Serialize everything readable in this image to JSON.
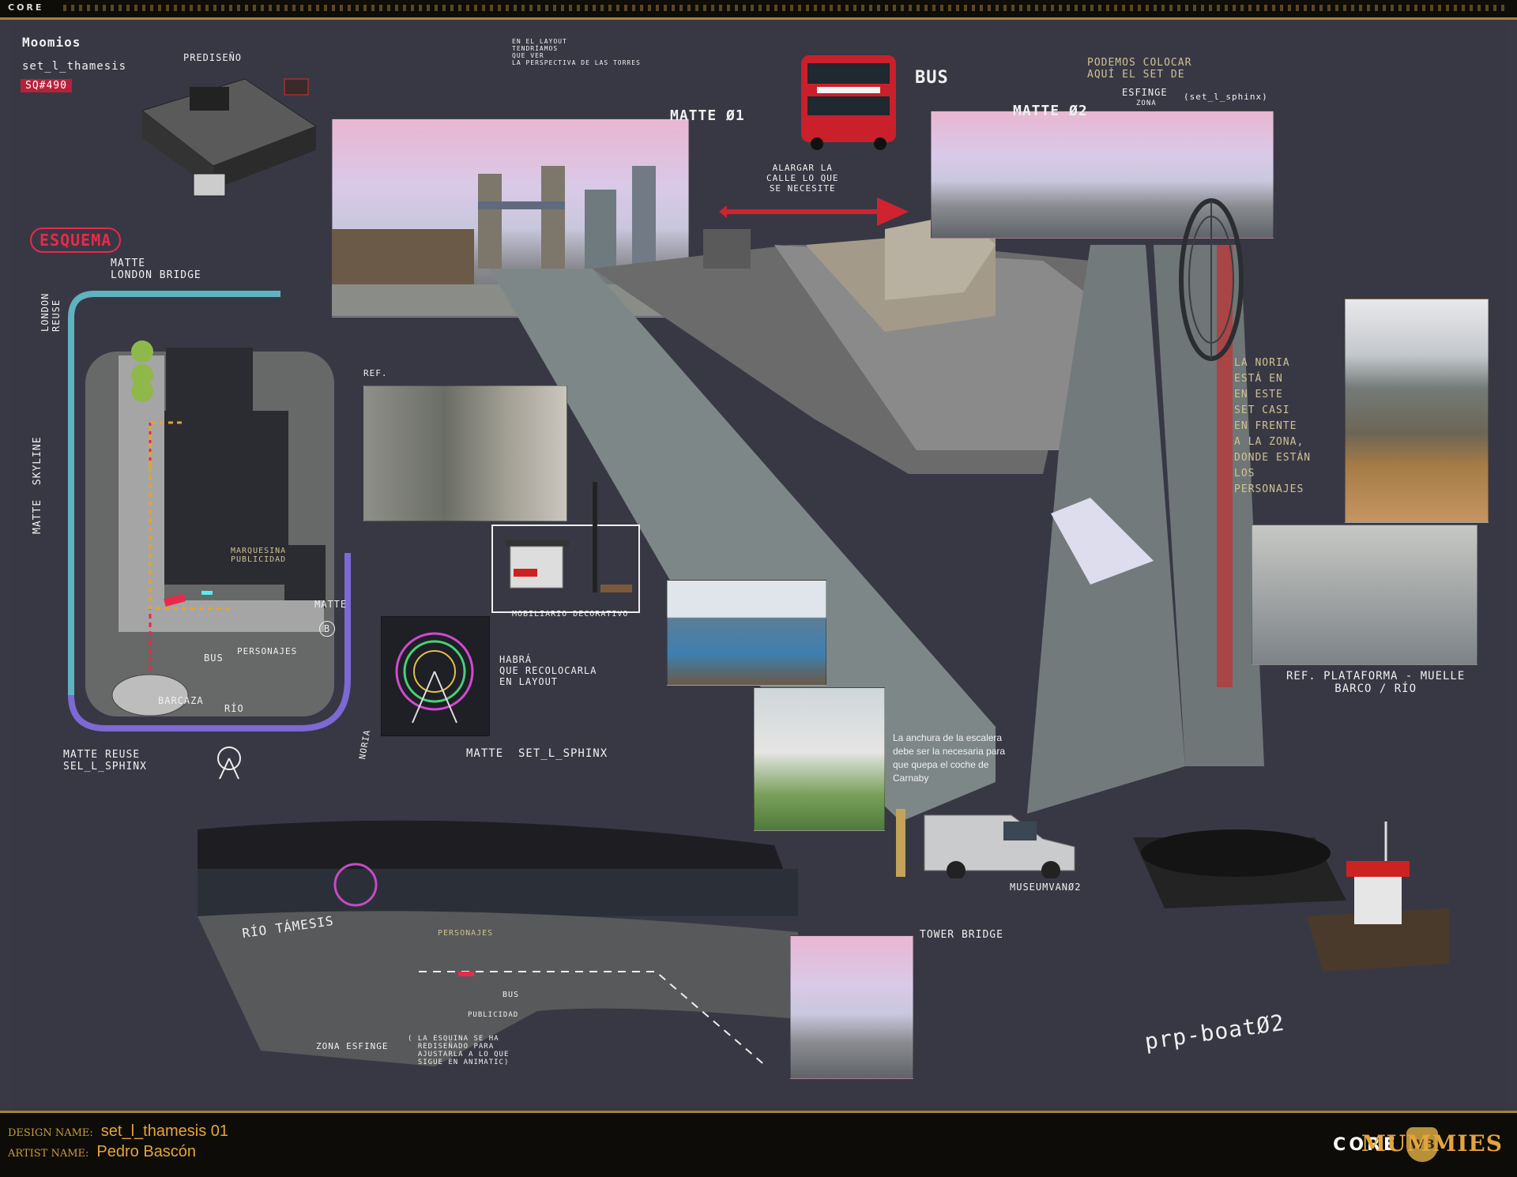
{
  "header": {
    "logo": "CORE"
  },
  "title_block": {
    "project": "Moomios",
    "set": "set_l_thamesis",
    "sequence": "SQ#490"
  },
  "labels": {
    "prediseno": "PREDISEÑO",
    "esquema": "ESQUEMA",
    "matte_london_bridge": "MATTE\nLONDON BRIDGE",
    "london_reuse": "LONDON\nREUSE",
    "matte_skyline": "MATTE  SKYLINE",
    "marquesina": "MARQUESINA\nPUBLICIDAD",
    "matte_b": "MATTE",
    "b_badge": "B",
    "bus_small": "BUS",
    "personajes_small": "PERSONAJES",
    "barcaza": "BARCAZA",
    "rio": "RÍO",
    "matte_reuse": "MATTE REUSE\nSEL_L_SPHINX",
    "layout_note": "EN EL LAYOUT\nTENDRÍAMOS\nQUE VER\nLA PERSPECTIVA DE LAS TORRES",
    "matte_01": "MATTE Ø1",
    "bus": "BUS",
    "alargar": "ALARGAR LA\nCALLE LO QUE\nSE NECESITE",
    "podemos": "PODEMOS COLOCAR\nAQUÍ EL SET DE",
    "esfinge": "ESFINGE",
    "esfinge_set": "(set_l_sphinx)",
    "zona": "ZONA",
    "matte_02": "MATTE Ø2",
    "noria_note": "LA NORIA\nESTÁ EN\nEN ESTE\nSET CASI\nEN FRENTE\nA LA ZONA,\nDONDE ESTÁN\nLOS\nPERSONAJES",
    "ref": "REF.",
    "mobiliario": "MOBILIARIO DECORATIVO",
    "habra": "HABRÁ\nQUE RECOLOCARLA\nEN LAYOUT",
    "noria": "NORIA",
    "matte_set_sphinx": "MATTE  SET_L_SPHINX",
    "escalera_note": "La anchura de la escalera\ndebe ser la necesaria para\nque quepa el coche de\nCarnaby",
    "museum_van": "MUSEUMVANØ2",
    "ref_plataforma": "REF. PLATAFORMA - MUELLE\nBARCO / RÍO",
    "tower_bridge": "TOWER BRIDGE",
    "rio_tamesis": "RÍO TÁMESIS",
    "personajes": "PERSONAJES",
    "bus_bottom": "BUS",
    "publicidad": "PUBLICIDAD",
    "zona_esfinge": "ZONA ESFINGE",
    "esquina_note": "( LA ESQUINA SE HA\n  REDISEÑADO PARA\n  AJUSTARLA A LO QUE\n  SIGUE EN ANIMATIC)",
    "prp_boat": "prp-boatØ2"
  },
  "footer": {
    "design_label": "DESIGN NAME:",
    "design_value": "set_l_thamesis 01",
    "artist_label": "ARTIST NAME:",
    "artist_value": "Pedro Bascón",
    "core": "CORE",
    "wb": "WB",
    "mummies": "MUMMIES"
  },
  "colors": {
    "background": "#383845",
    "accent_red": "#e82a4a",
    "gold": "#c89c3c",
    "teal": "#5aa3ad",
    "purple": "#7b6bd0"
  }
}
